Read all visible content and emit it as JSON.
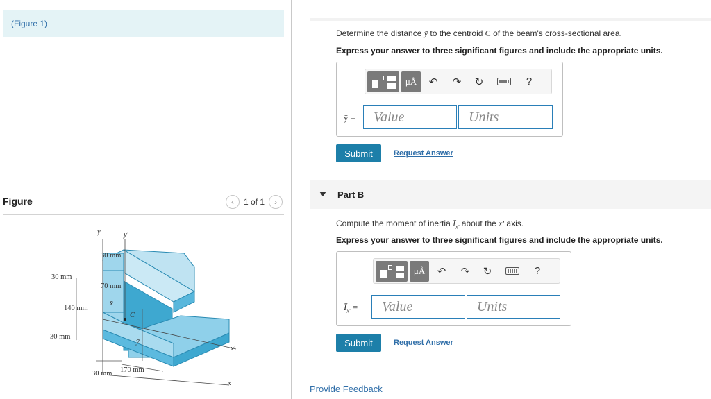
{
  "left_pane": {
    "figure_link": "(Figure 1)",
    "figure_title": "Figure",
    "pager": {
      "text": "1 of 1",
      "prev_icon": "chevron-left-icon",
      "next_icon": "chevron-right-icon"
    },
    "figure_labels": {
      "y": "y",
      "y_prime": "y′",
      "dim_30_top": "30 mm",
      "dim_30_left": "30 mm",
      "dim_70": "70 mm",
      "dim_140": "140 mm",
      "centroid": "C",
      "x_bar": "x̄",
      "y_bar": "ȳ",
      "dim_30_bottom": "30 mm",
      "dim_30_base": "30 mm",
      "dim_170": "170 mm",
      "x_prime": "x′",
      "x": "x"
    }
  },
  "part_a": {
    "question_prefix": "Determine the distance ",
    "question_symbol": "ȳ",
    "question_mid": " to the centroid ",
    "question_c": "C",
    "question_suffix": " of the beam's cross-sectional area.",
    "instruction": "Express your answer to three significant figures and include the appropriate units.",
    "answer_label": "ȳ =",
    "value_placeholder": "Value",
    "units_placeholder": "Units",
    "submit_label": "Submit",
    "request_answer": "Request Answer"
  },
  "part_b": {
    "title": "Part B",
    "question_prefix": "Compute the moment of inertia ",
    "question_symbol": "Ī",
    "question_sub": "x′",
    "question_mid": " about the ",
    "question_axis": "x′",
    "question_suffix": " axis.",
    "instruction": "Express your answer to three significant figures and include the appropriate units.",
    "answer_label": "Ī",
    "answer_sub": "x′",
    "answer_eq": " =",
    "value_placeholder": "Value",
    "units_placeholder": "Units",
    "submit_label": "Submit",
    "request_answer": "Request Answer"
  },
  "toolbar": {
    "templates_icon": "templates-icon",
    "units_label": "μÅ",
    "undo_icon": "undo-icon",
    "redo_icon": "redo-icon",
    "reset_icon": "reset-icon",
    "keyboard_icon": "keyboard-icon",
    "help_label": "?"
  },
  "footer": {
    "feedback": "Provide Feedback"
  },
  "colors": {
    "accent": "#1d7fa9",
    "link": "#2f6ea8",
    "beam_light": "#a8d8ec",
    "beam_dark": "#3aa7cf"
  }
}
